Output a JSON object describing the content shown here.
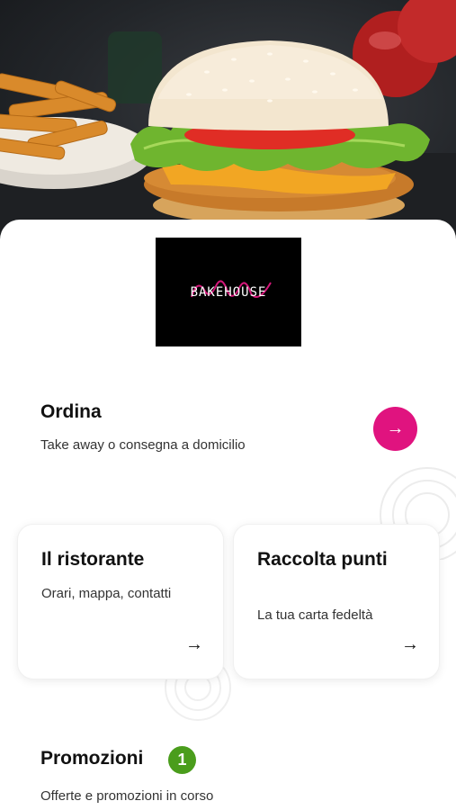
{
  "hero": {
    "image": "burger-hero-photo"
  },
  "logo": {
    "text": "BAKEHOUSE"
  },
  "order": {
    "title": "Ordina",
    "subtitle": "Take away o consegna a domicilio",
    "button_icon": "arrow-right-icon",
    "button_color": "#e0137f"
  },
  "cards": [
    {
      "title": "Il ristorante",
      "subtitle": "Orari, mappa, contatti",
      "icon": "arrow-right-icon"
    },
    {
      "title": "Raccolta punti",
      "subtitle": "La tua carta fedeltà",
      "icon": "arrow-right-icon"
    }
  ],
  "promo": {
    "title": "Promozioni",
    "badge": "1",
    "badge_color": "#4a9d1c",
    "subtitle": "Offerte e promozioni in corso"
  },
  "glyphs": {
    "arrow": "→"
  }
}
